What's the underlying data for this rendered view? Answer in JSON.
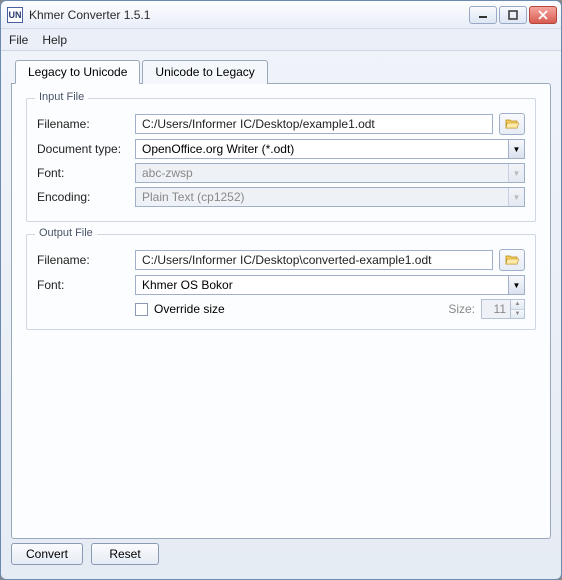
{
  "app_icon_text": "UN",
  "window_title": "Khmer Converter 1.5.1",
  "menu": {
    "file": "File",
    "help": "Help"
  },
  "tabs": {
    "legacy_to_unicode": "Legacy to Unicode",
    "unicode_to_legacy": "Unicode to Legacy"
  },
  "input_group": {
    "legend": "Input File",
    "filename_label": "Filename:",
    "filename_value": "C:/Users/Informer IC/Desktop/example1.odt",
    "doctype_label": "Document type:",
    "doctype_value": "OpenOffice.org Writer (*.odt)",
    "font_label": "Font:",
    "font_value": "abc-zwsp",
    "encoding_label": "Encoding:",
    "encoding_value": "Plain Text (cp1252)"
  },
  "output_group": {
    "legend": "Output File",
    "filename_label": "Filename:",
    "filename_value": "C:/Users/Informer IC/Desktop\\converted-example1.odt",
    "font_label": "Font:",
    "font_value": "Khmer OS Bokor",
    "override_label": "Override size",
    "size_label": "Size:",
    "size_value": "11"
  },
  "buttons": {
    "convert": "Convert",
    "reset": "Reset"
  }
}
